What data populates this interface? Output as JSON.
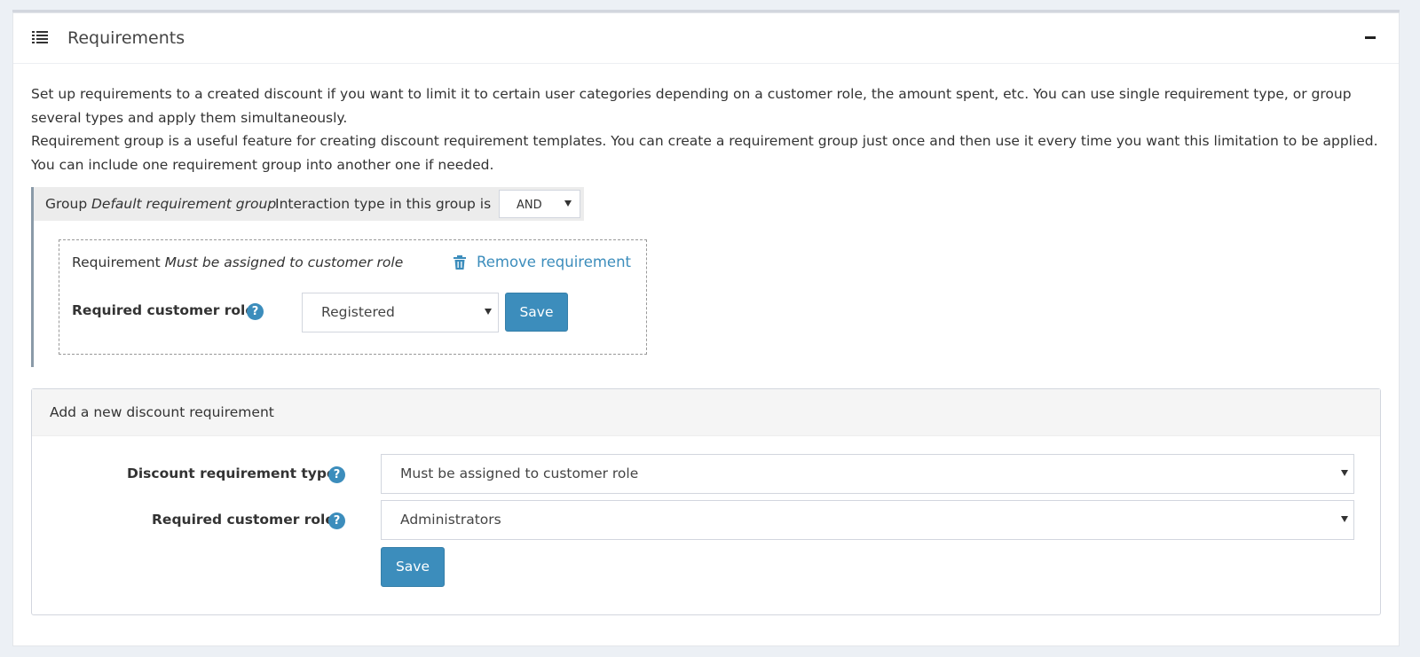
{
  "panel": {
    "title": "Requirements",
    "icons": {
      "header": "list-icon",
      "collapse": "minus-icon"
    }
  },
  "intro": {
    "line1": "Set up requirements to a created discount if you want to limit it to certain user categories depending on a customer role, the amount spent, etc. You can use single requirement type, or group several types and apply them simultaneously.",
    "line2": "Requirement group is a useful feature for creating discount requirement templates. You can create a requirement group just once and then use it every time you want this limitation to be applied. You can include one requirement group into another one if needed."
  },
  "group": {
    "prefix": "Group",
    "name": "Default requirement group",
    "interaction_label": "Interaction type in this group is",
    "interaction_value": "AND",
    "requirement": {
      "prefix": "Requirement",
      "name": "Must be assigned to customer role",
      "remove_label": "Remove requirement",
      "role_label": "Required customer role",
      "role_value": "Registered",
      "save_label": "Save"
    }
  },
  "add_requirement": {
    "title": "Add a new discount requirement",
    "type_label": "Discount requirement type",
    "type_value": "Must be assigned to customer role",
    "role_label": "Required customer role",
    "role_value": "Administrators",
    "save_label": "Save"
  },
  "help_glyph": "?",
  "colors": {
    "accent": "#3c8dbc",
    "page_bg": "#ecf0f5",
    "group_border": "#8a9aa8"
  }
}
